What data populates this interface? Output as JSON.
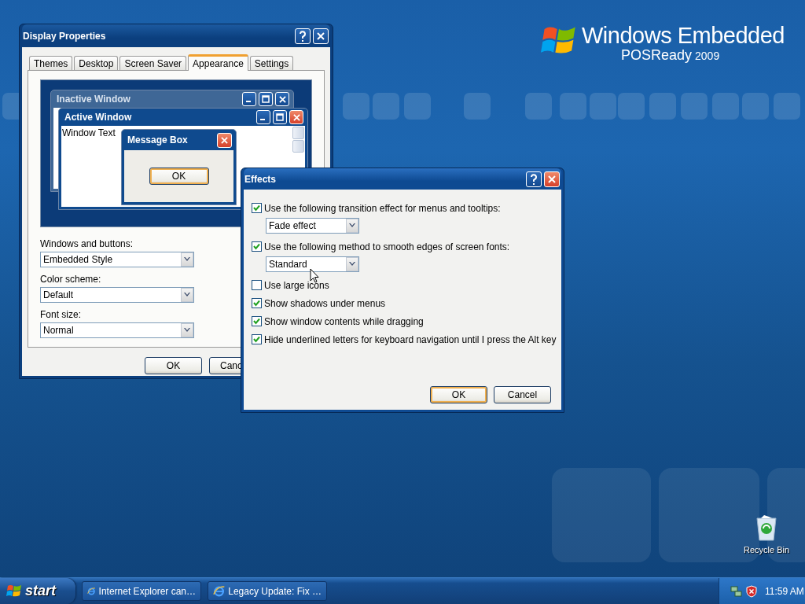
{
  "desktop": {
    "logo": {
      "title": "Windows Embedded",
      "subtitle": "POSReady",
      "year": "2009"
    },
    "icons": [
      {
        "label": "Recycle Bin"
      }
    ]
  },
  "display_properties": {
    "title": "Display Properties",
    "tabs": [
      {
        "label": "Themes",
        "selected": false
      },
      {
        "label": "Desktop",
        "selected": false
      },
      {
        "label": "Screen Saver",
        "selected": false
      },
      {
        "label": "Appearance",
        "selected": true
      },
      {
        "label": "Settings",
        "selected": false
      }
    ],
    "preview": {
      "inactive_title": "Inactive Window",
      "active_title": "Active Window",
      "window_text": "Window Text",
      "message_title": "Message Box",
      "message_button": "OK"
    },
    "fields": [
      {
        "label": "Windows and buttons:",
        "value": "Embedded Style"
      },
      {
        "label": "Color scheme:",
        "value": "Default"
      },
      {
        "label": "Font size:",
        "value": "Normal"
      }
    ],
    "buttons": [
      "OK",
      "Canc"
    ]
  },
  "effects": {
    "title": "Effects",
    "items": [
      {
        "kind": "checkbox",
        "label": "Use the following transition effect for menus and tooltips:",
        "checked": true
      },
      {
        "kind": "dropdown",
        "value": "Fade effect"
      },
      {
        "kind": "checkbox",
        "label": "Use the following method to smooth edges of screen fonts:",
        "checked": true
      },
      {
        "kind": "dropdown",
        "value": "Standard"
      },
      {
        "kind": "checkbox",
        "label": "Use large icons",
        "checked": false
      },
      {
        "kind": "checkbox",
        "label": "Show shadows under menus",
        "checked": true
      },
      {
        "kind": "checkbox",
        "label": "Show window contents while dragging",
        "checked": true
      },
      {
        "kind": "checkbox",
        "label": "Hide underlined letters for keyboard navigation until I press the Alt key",
        "checked": true
      }
    ],
    "buttons": [
      {
        "label": "OK",
        "default": true
      },
      {
        "label": "Cancel",
        "default": false
      }
    ]
  },
  "taskbar": {
    "start": "start",
    "tasks": [
      {
        "label": "Internet Explorer can…"
      },
      {
        "label": "Legacy Update: Fix …"
      }
    ],
    "clock": "11:59 AM"
  }
}
